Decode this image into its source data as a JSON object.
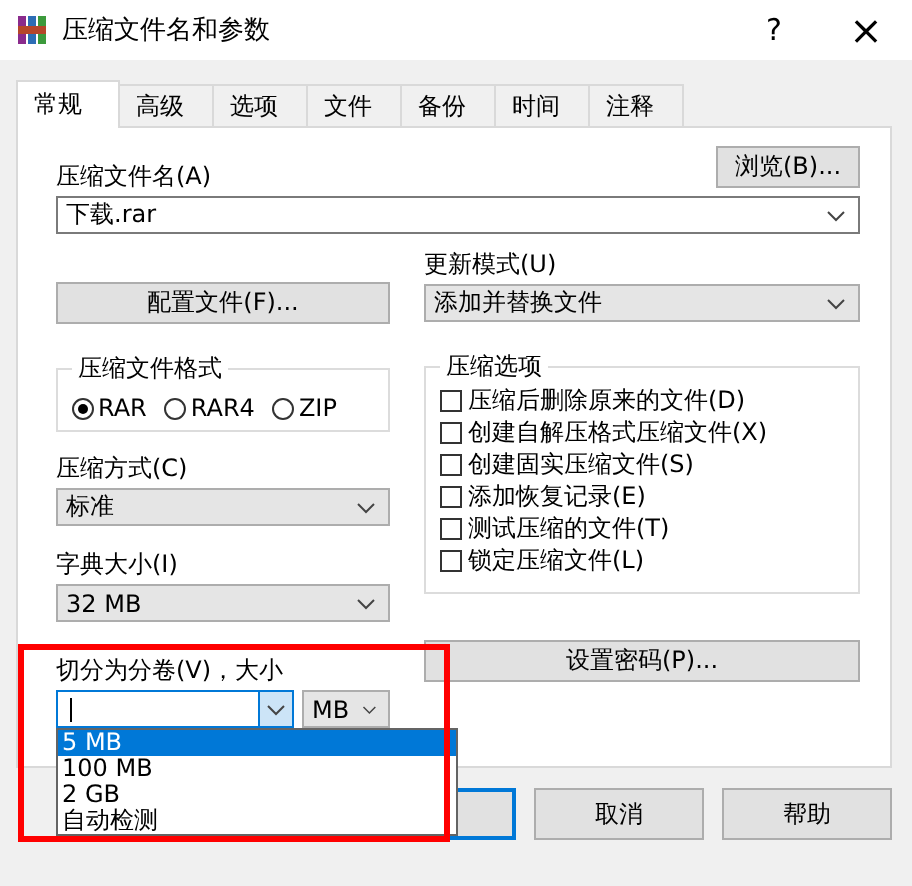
{
  "window": {
    "title": "压缩文件名和参数",
    "help": "?",
    "close": "×"
  },
  "tabs": [
    {
      "label": "常规",
      "selected": true
    },
    {
      "label": "高级",
      "selected": false
    },
    {
      "label": "选项",
      "selected": false
    },
    {
      "label": "文件",
      "selected": false
    },
    {
      "label": "备份",
      "selected": false
    },
    {
      "label": "时间",
      "selected": false
    },
    {
      "label": "注释",
      "selected": false
    }
  ],
  "archive_name": {
    "label": "压缩文件名(A)",
    "value": "下载.rar",
    "browse": "浏览(B)..."
  },
  "profiles_button": "配置文件(F)...",
  "update_mode": {
    "label": "更新模式(U)",
    "value": "添加并替换文件"
  },
  "archive_format": {
    "title": "压缩文件格式",
    "options": [
      {
        "label": "RAR",
        "selected": true
      },
      {
        "label": "RAR4",
        "selected": false
      },
      {
        "label": "ZIP",
        "selected": false
      }
    ]
  },
  "compression_method": {
    "label": "压缩方式(C)",
    "value": "标准"
  },
  "dictionary_size": {
    "label": "字典大小(I)",
    "value": "32 MB"
  },
  "split": {
    "label": "切分为分卷(V)，大小",
    "unit": "MB",
    "expanded": true,
    "options": [
      {
        "label": "5 MB",
        "selected": true
      },
      {
        "label": "100 MB",
        "selected": false
      },
      {
        "label": "2 GB",
        "selected": false
      },
      {
        "label": "自动检测",
        "selected": false
      }
    ]
  },
  "compression_options": {
    "title": "压缩选项",
    "items": [
      {
        "label": "压缩后删除原来的文件(D)",
        "checked": false
      },
      {
        "label": "创建自解压格式压缩文件(X)",
        "checked": false
      },
      {
        "label": "创建固实压缩文件(S)",
        "checked": false
      },
      {
        "label": "添加恢复记录(E)",
        "checked": false
      },
      {
        "label": "测试压缩的文件(T)",
        "checked": false
      },
      {
        "label": "锁定压缩文件(L)",
        "checked": false
      }
    ]
  },
  "password_button": "设置密码(P)...",
  "buttons": [
    {
      "kind": "default"
    },
    {
      "kind": "normal",
      "label": "取消"
    },
    {
      "kind": "normal",
      "label": "帮助"
    }
  ]
}
